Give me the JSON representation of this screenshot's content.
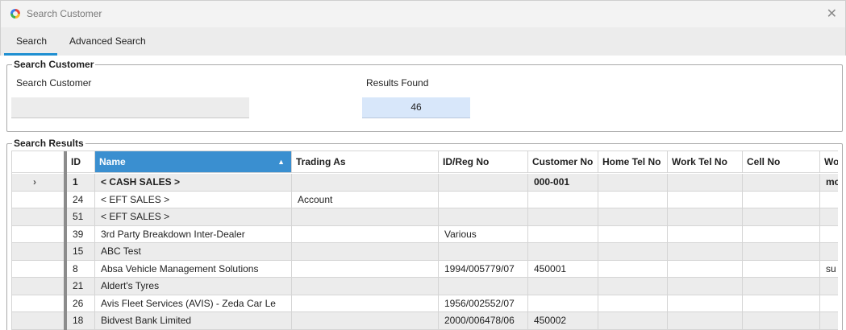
{
  "window": {
    "title": "Search Customer",
    "close_glyph": "✕"
  },
  "tabs": {
    "search": "Search",
    "advanced": "Advanced Search"
  },
  "search_group": {
    "legend": "Search Customer",
    "search_label": "Search Customer",
    "search_value": "",
    "results_label": "Results Found",
    "results_value": "46"
  },
  "results_group": {
    "legend": "Search Results"
  },
  "grid": {
    "headers": {
      "id": "ID",
      "name": "Name",
      "trading_as": "Trading As",
      "reg_no": "ID/Reg No",
      "customer_no": "Customer No",
      "home_tel": "Home Tel No",
      "work_tel": "Work Tel No",
      "cell_no": "Cell No",
      "wo": "Wo"
    },
    "sort_indicator": "▲",
    "current_row_indicator": "›",
    "rows": [
      {
        "id": "1",
        "name": "< CASH SALES >",
        "trading_as": "",
        "reg_no": "",
        "customer_no": "000-001",
        "home_tel": "",
        "work_tel": "",
        "cell_no": "",
        "wo": "mo"
      },
      {
        "id": "24",
        "name": "< EFT SALES >",
        "trading_as": "Account",
        "reg_no": "",
        "customer_no": "",
        "home_tel": "",
        "work_tel": "",
        "cell_no": "",
        "wo": ""
      },
      {
        "id": "51",
        "name": "< EFT SALES >",
        "trading_as": "",
        "reg_no": "",
        "customer_no": "",
        "home_tel": "",
        "work_tel": "",
        "cell_no": "",
        "wo": ""
      },
      {
        "id": "39",
        "name": "3rd Party Breakdown Inter-Dealer",
        "trading_as": "",
        "reg_no": "Various",
        "customer_no": "",
        "home_tel": "",
        "work_tel": "",
        "cell_no": "",
        "wo": ""
      },
      {
        "id": "15",
        "name": "ABC Test",
        "trading_as": "",
        "reg_no": "",
        "customer_no": "",
        "home_tel": "",
        "work_tel": "",
        "cell_no": "",
        "wo": ""
      },
      {
        "id": "8",
        "name": "Absa Vehicle Management Solutions",
        "trading_as": "",
        "reg_no": "1994/005779/07",
        "customer_no": "450001",
        "home_tel": "",
        "work_tel": "",
        "cell_no": "",
        "wo": "su"
      },
      {
        "id": "21",
        "name": "Aldert's Tyres",
        "trading_as": "",
        "reg_no": "",
        "customer_no": "",
        "home_tel": "",
        "work_tel": "",
        "cell_no": "",
        "wo": ""
      },
      {
        "id": "26",
        "name": "Avis Fleet Services (AVIS) - Zeda Car Le",
        "trading_as": "",
        "reg_no": "1956/002552/07",
        "customer_no": "",
        "home_tel": "",
        "work_tel": "",
        "cell_no": "",
        "wo": ""
      },
      {
        "id": "18",
        "name": "Bidvest Bank Limited",
        "trading_as": "",
        "reg_no": "2000/006478/06",
        "customer_no": "450002",
        "home_tel": "",
        "work_tel": "",
        "cell_no": "",
        "wo": ""
      }
    ]
  }
}
